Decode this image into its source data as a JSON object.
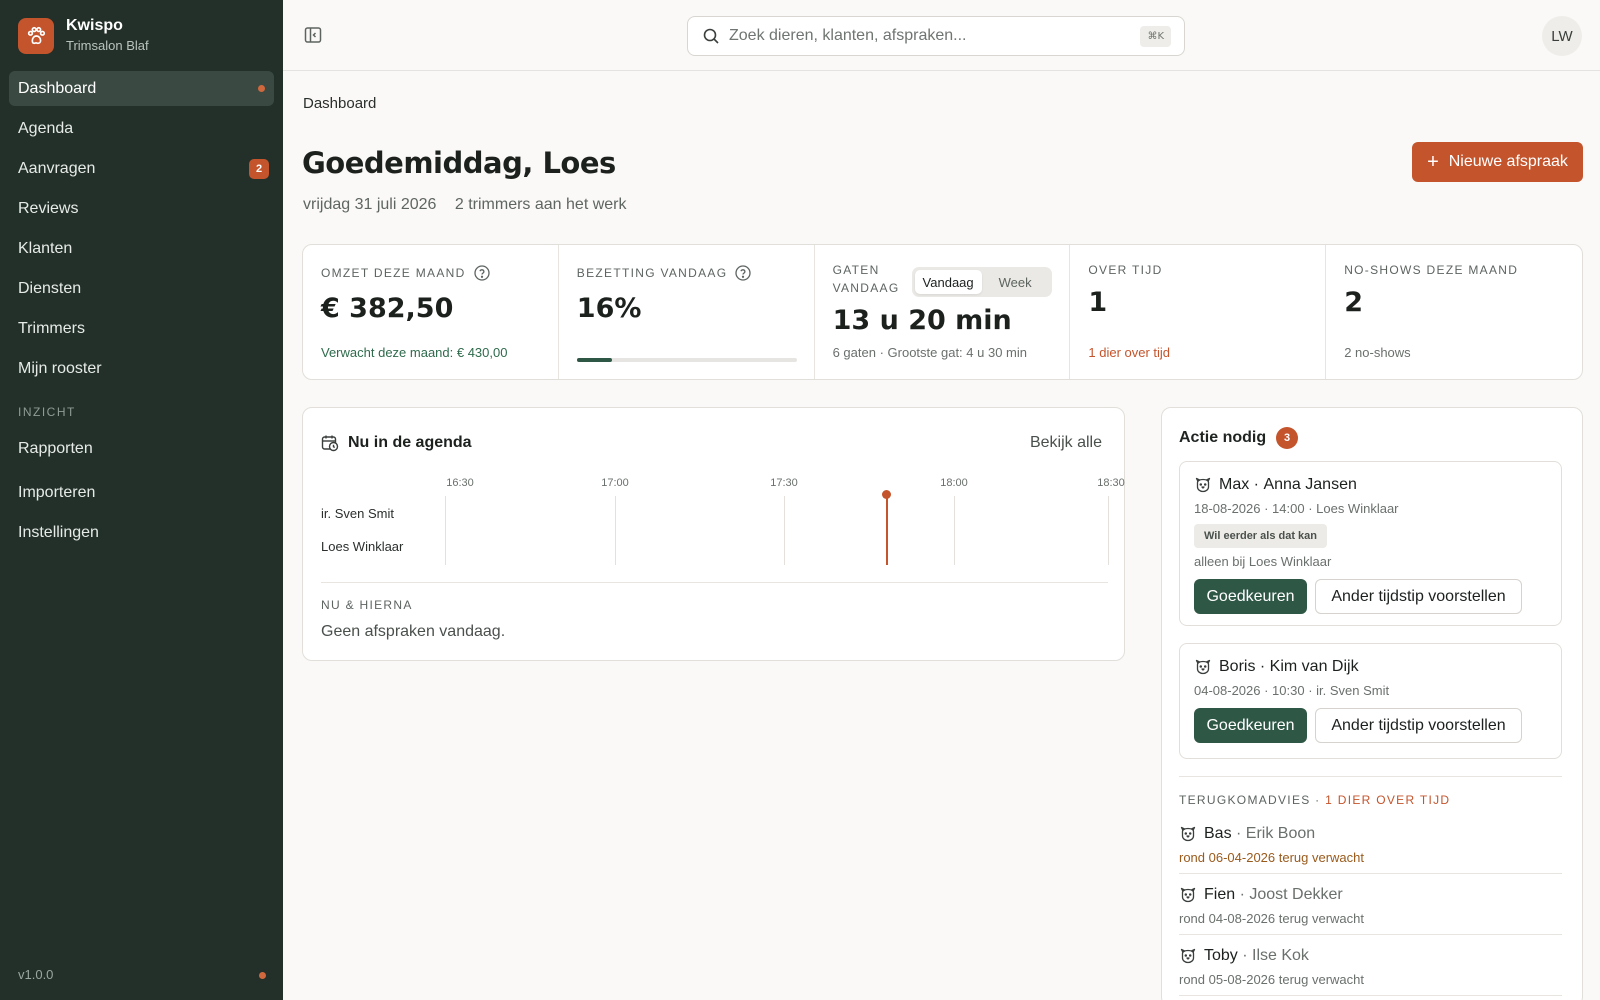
{
  "brand": {
    "name": "Kwispo",
    "subtitle": "Trimsalon Blaf"
  },
  "sidebar": {
    "items": [
      {
        "label": "Dashboard",
        "active": true
      },
      {
        "label": "Agenda"
      },
      {
        "label": "Aanvragen",
        "badge": "2"
      },
      {
        "label": "Reviews"
      },
      {
        "label": "Klanten"
      },
      {
        "label": "Diensten"
      },
      {
        "label": "Trimmers"
      },
      {
        "label": "Mijn rooster"
      }
    ],
    "section_label": "INZICHT",
    "insight_items": [
      {
        "label": "Rapporten"
      },
      {
        "label": "Importeren"
      },
      {
        "label": "Instellingen"
      }
    ],
    "version": "v1.0.0"
  },
  "search": {
    "placeholder": "Zoek dieren, klanten, afspraken...",
    "shortcut": "⌘K"
  },
  "user": {
    "initials": "LW"
  },
  "breadcrumb": "Dashboard",
  "page": {
    "title": "Goedemiddag, Loes",
    "date": "vrijdag 31 juli 2026",
    "trimmers": "2 trimmers aan het werk",
    "new_button": "Nieuwe afspraak"
  },
  "kpis": {
    "revenue": {
      "label": "OMZET DEZE MAAND",
      "value": "€ 382,50",
      "note": "Verwacht deze maand: € 430,00"
    },
    "occupancy": {
      "label": "BEZETTING VANDAAG",
      "value": "16%",
      "fraction": 0.16
    },
    "gaps": {
      "label_line1": "GATEN",
      "label_line2": "VANDAAG",
      "value": "13 u 20 min",
      "note": "6 gaten · Grootste gat: 4 u 30 min",
      "toggle": [
        "Vandaag",
        "Week"
      ],
      "toggle_selected": "Vandaag"
    },
    "overdue": {
      "label": "OVER TIJD",
      "value": "1",
      "note": "1 dier over tijd"
    },
    "noshows": {
      "label": "NO-SHOWS DEZE MAAND",
      "value": "2",
      "note": "2 no-shows"
    }
  },
  "agenda": {
    "title": "Nu in de agenda",
    "see_all": "Bekijk alle",
    "ticks": [
      "16:30",
      "17:00",
      "17:30",
      "18:00",
      "18:30"
    ],
    "rows": [
      "ir. Sven Smit",
      "Loes Winklaar"
    ],
    "now_section": "NU & HIERNA",
    "empty": "Geen afspraken vandaag."
  },
  "action": {
    "title": "Actie nodig",
    "count": "3",
    "requests": [
      {
        "pet": "Max",
        "owner": "Anna Jansen",
        "meta": "18-08-2026 · 14:00 · Loes Winklaar",
        "tag": "Wil eerder als dat kan",
        "note": "alleen bij Loes Winklaar",
        "approve": "Goedkeuren",
        "propose": "Ander tijdstip voorstellen"
      },
      {
        "pet": "Boris",
        "owner": "Kim van Dijk",
        "meta": "04-08-2026 · 10:30 · ir. Sven Smit",
        "approve": "Goedkeuren",
        "propose": "Ander tijdstip voorstellen"
      }
    ],
    "return_label": "TERUGKOMADVIES · ",
    "return_highlight": "1 DIER OVER TIJD",
    "returns": [
      {
        "pet": "Bas",
        "owner": "Erik Boon",
        "sub": "rond 06-04-2026 terug verwacht",
        "late": true
      },
      {
        "pet": "Fien",
        "owner": "Joost Dekker",
        "sub": "rond 04-08-2026 terug verwacht"
      },
      {
        "pet": "Toby",
        "owner": "Ilse Kok",
        "sub": "rond 05-08-2026 terug verwacht"
      }
    ]
  },
  "colors": {
    "sidebar": "#233029",
    "accent": "#c4542c",
    "primary": "#2f5746"
  }
}
